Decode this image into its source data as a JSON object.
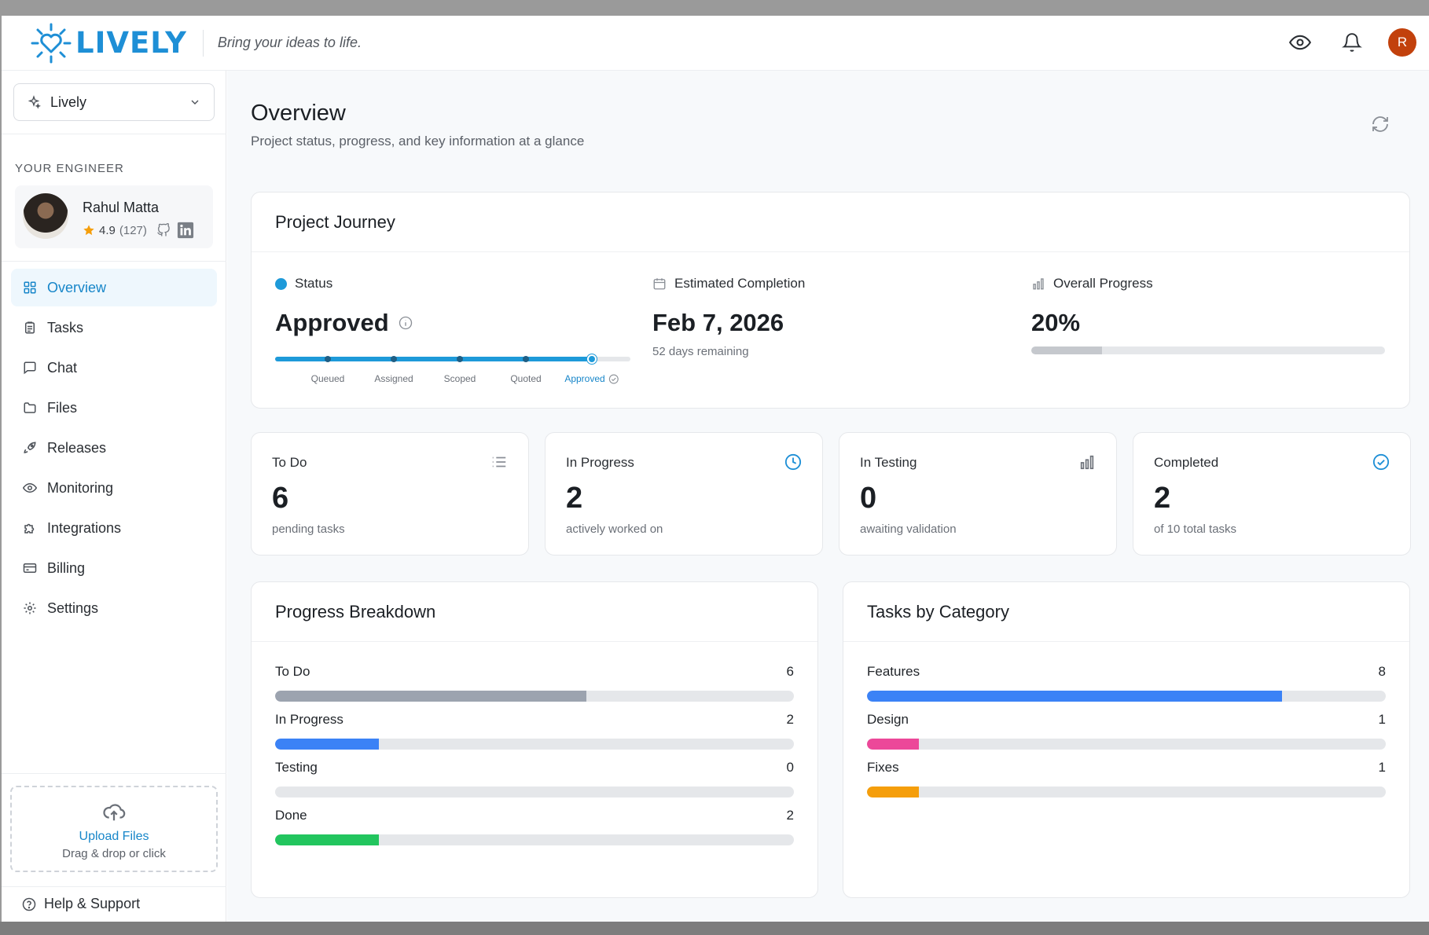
{
  "header": {
    "brand": "LIVELY",
    "tagline": "Bring your ideas to life.",
    "avatar_initial": "R",
    "brand_color": "#1e8fd6"
  },
  "sidebar": {
    "project": "Lively",
    "engineer_heading": "YOUR ENGINEER",
    "engineer": {
      "name": "Rahul Matta",
      "rating": "4.9",
      "reviews": "(127)"
    },
    "nav": [
      {
        "label": "Overview",
        "icon": "grid-icon",
        "active": true
      },
      {
        "label": "Tasks",
        "icon": "clipboard-icon"
      },
      {
        "label": "Chat",
        "icon": "chat-icon"
      },
      {
        "label": "Files",
        "icon": "folder-icon"
      },
      {
        "label": "Releases",
        "icon": "rocket-icon"
      },
      {
        "label": "Monitoring",
        "icon": "eye-icon"
      },
      {
        "label": "Integrations",
        "icon": "puzzle-icon"
      },
      {
        "label": "Billing",
        "icon": "credit-card-icon"
      },
      {
        "label": "Settings",
        "icon": "gear-icon"
      }
    ],
    "upload": {
      "title": "Upload Files",
      "subtitle": "Drag & drop or click"
    },
    "help": "Help & Support"
  },
  "main": {
    "title": "Overview",
    "subtitle": "Project status, progress, and key information at a glance",
    "journey": {
      "title": "Project Journey",
      "status_label": "Status",
      "status_value": "Approved",
      "steps": [
        "Queued",
        "Assigned",
        "Scoped",
        "Quoted",
        "Approved"
      ],
      "current_step": 4,
      "completion_label": "Estimated Completion",
      "completion_value": "Feb 7, 2026",
      "completion_remaining": "52 days remaining",
      "progress_label": "Overall Progress",
      "progress_value": "20%",
      "progress_fraction": 0.2
    },
    "stats": [
      {
        "label": "To Do",
        "value": "6",
        "sub": "pending tasks",
        "icon": "list-icon"
      },
      {
        "label": "In Progress",
        "value": "2",
        "sub": "actively worked on",
        "icon": "clock-icon"
      },
      {
        "label": "In Testing",
        "value": "0",
        "sub": "awaiting validation",
        "icon": "bar-chart-icon"
      },
      {
        "label": "Completed",
        "value": "2",
        "sub": "of 10 total tasks",
        "icon": "check-circle-icon"
      }
    ],
    "breakdown": {
      "title": "Progress Breakdown",
      "rows": [
        {
          "label": "To Do",
          "value": "6",
          "fraction": 0.6,
          "color": "#9ca3af"
        },
        {
          "label": "In Progress",
          "value": "2",
          "fraction": 0.2,
          "color": "#3b82f6"
        },
        {
          "label": "Testing",
          "value": "0",
          "fraction": 0,
          "color": "#9ca3af"
        },
        {
          "label": "Done",
          "value": "2",
          "fraction": 0.2,
          "color": "#22c55e"
        }
      ]
    },
    "categories": {
      "title": "Tasks by Category",
      "rows": [
        {
          "label": "Features",
          "value": "8",
          "fraction": 0.8,
          "color": "#3b82f6"
        },
        {
          "label": "Design",
          "value": "1",
          "fraction": 0.1,
          "color": "#ec4899"
        },
        {
          "label": "Fixes",
          "value": "1",
          "fraction": 0.1,
          "color": "#f59e0b"
        }
      ]
    }
  }
}
